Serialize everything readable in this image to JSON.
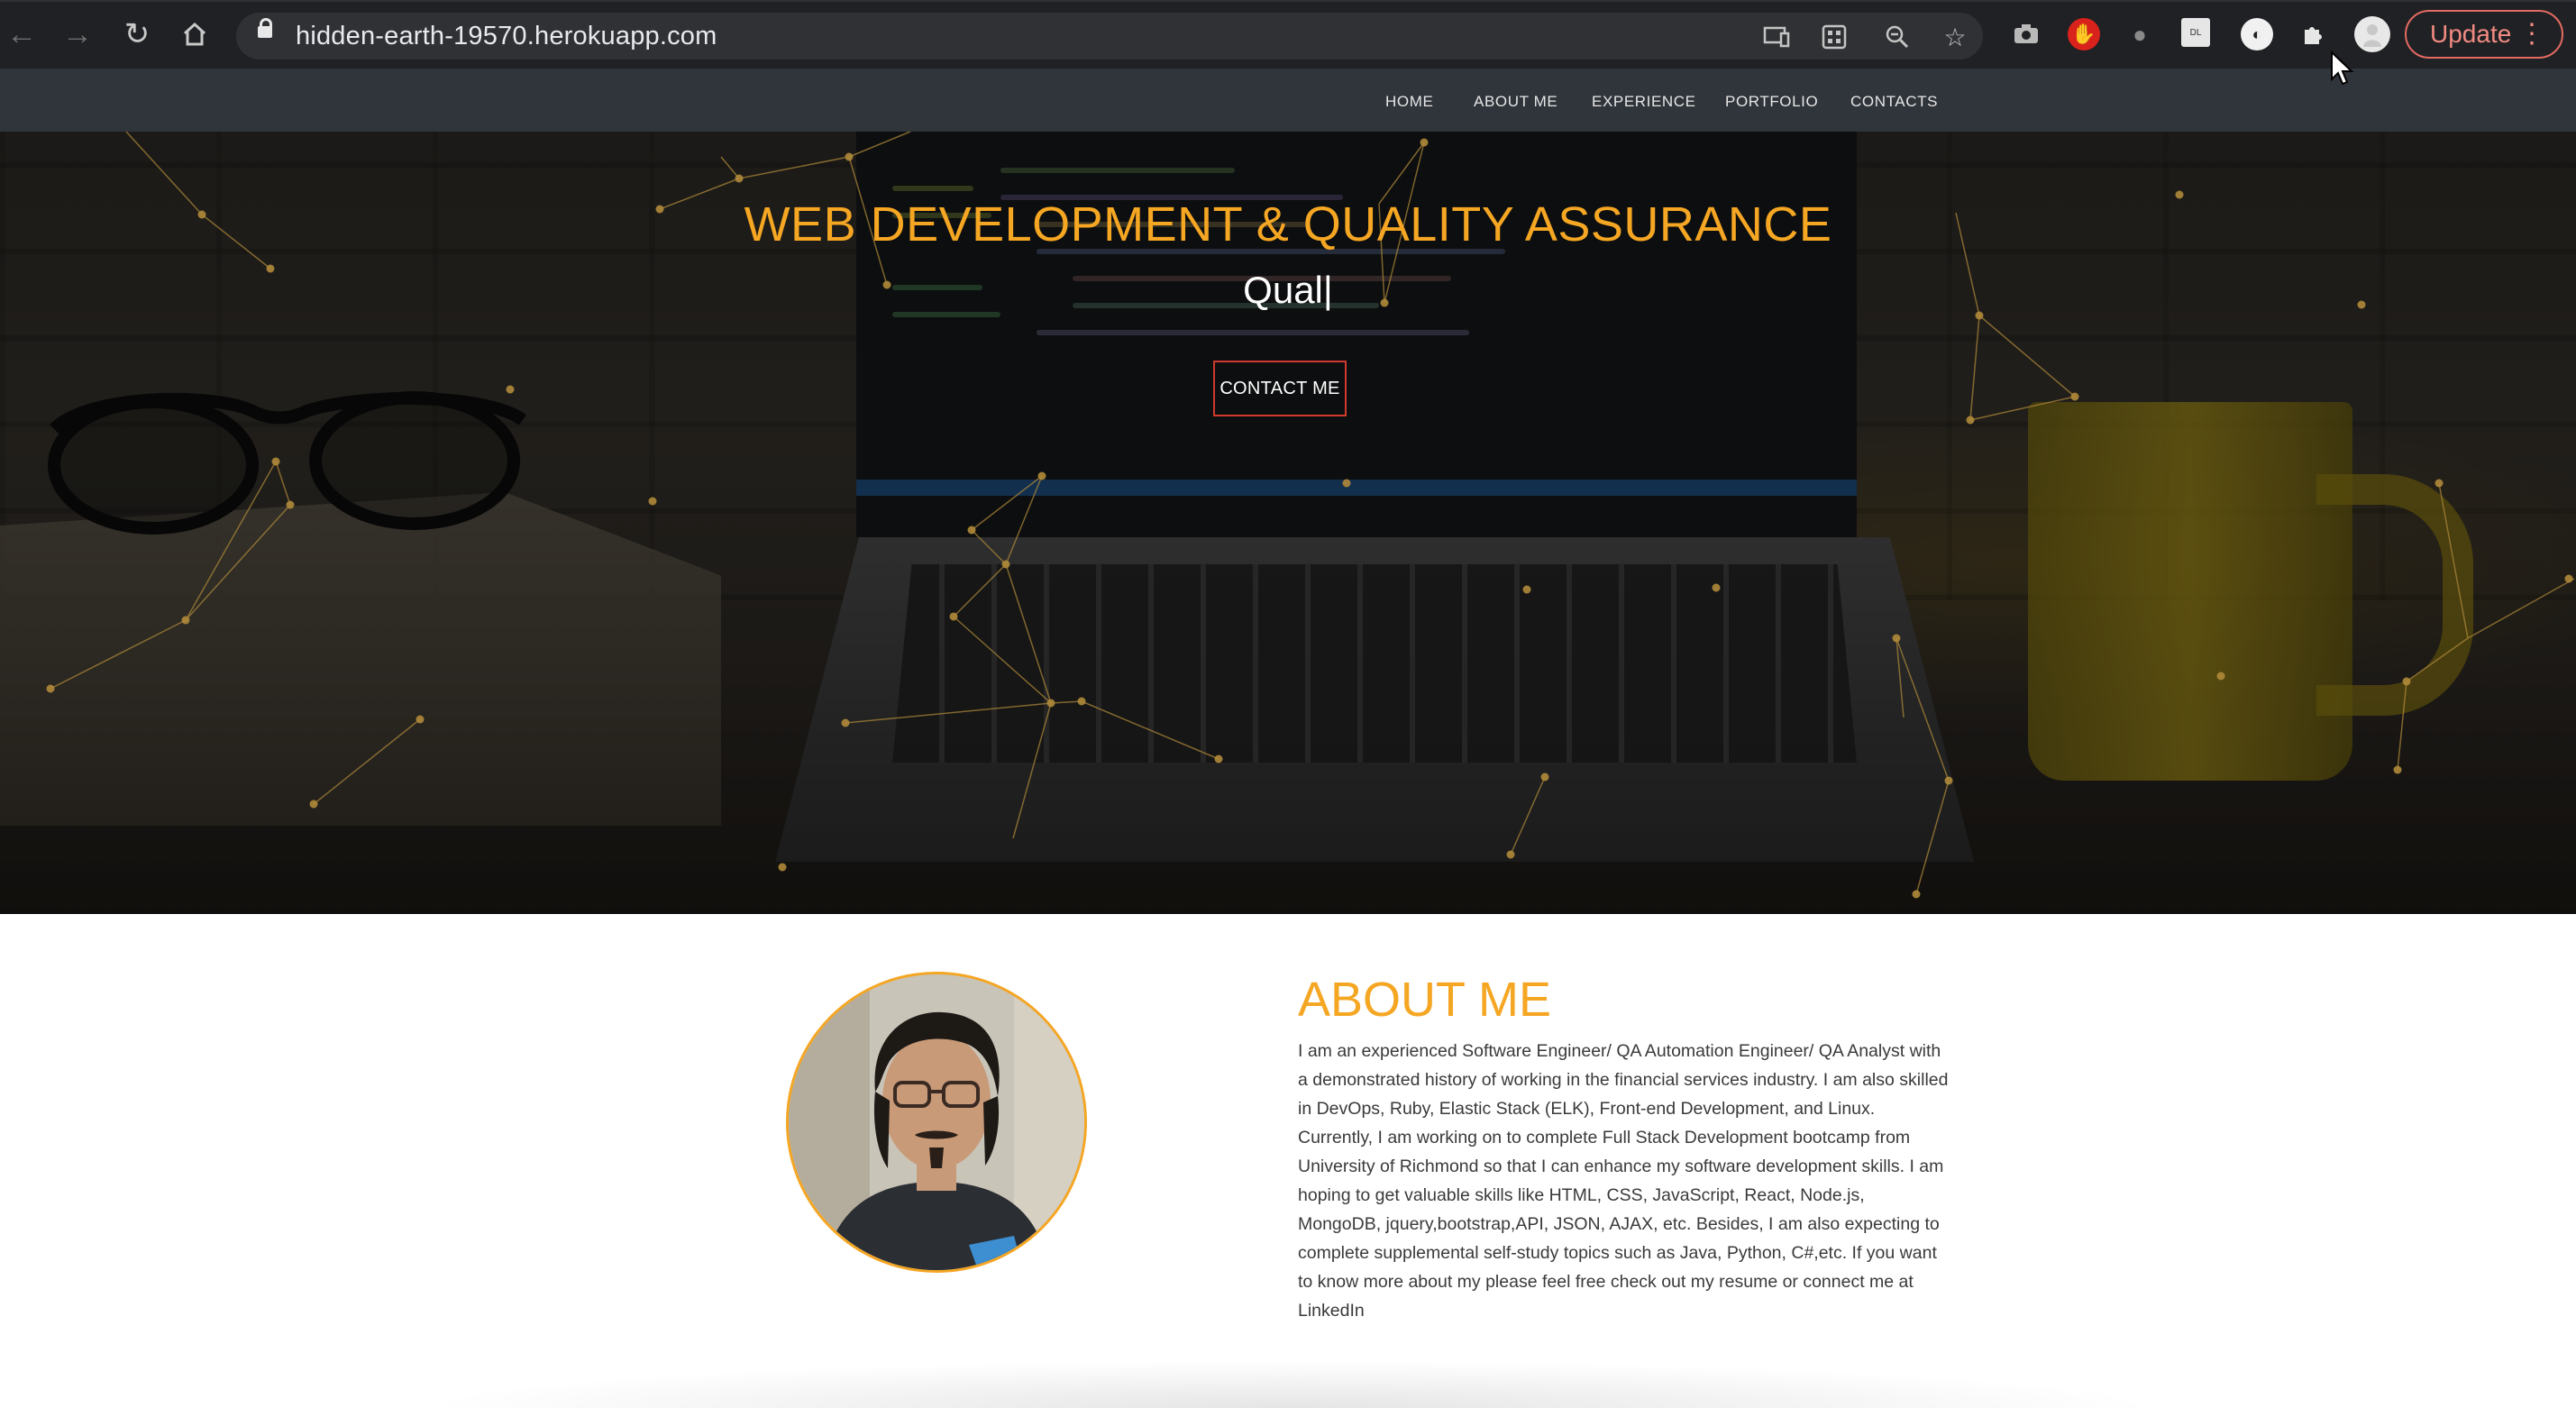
{
  "browser": {
    "url": "hidden-earth-19570.herokuapp.com",
    "update_label": "Update"
  },
  "nav": {
    "items": [
      "HOME",
      "ABOUT ME",
      "EXPERIENCE",
      "PORTFOLIO",
      "CONTACTS"
    ]
  },
  "hero": {
    "title": "WEB DEVELOPMENT & QUALITY ASSURANCE",
    "typed_text": "Qual|",
    "button_label": "CONTACT ME",
    "accent_color": "#f5a623",
    "button_border_color": "#d03a2f"
  },
  "about": {
    "title": "ABOUT ME",
    "body": "I am an experienced Software Engineer/ QA Automation Engineer/ QA Analyst with a demonstrated history of working in the financial services industry. I am also skilled in DevOps, Ruby, Elastic Stack (ELK), Front-end Development, and Linux. Currently, I am working on to complete Full Stack Development bootcamp from University of Richmond so that I can enhance my software development skills. I am hoping to get valuable skills like HTML, CSS, JavaScript, React, Node.js, MongoDB, jquery,bootstrap,API, JSON, AJAX, etc. Besides, I am also expecting to complete supplemental self-study topics such as Java, Python, C#,etc. If you want to know more about my please feel free check out my resume or connect me at LinkedIn"
  },
  "icons": {
    "back": "arrow-left-icon",
    "forward": "arrow-right-icon",
    "reload": "reload-icon",
    "home": "home-icon",
    "extensions": "puzzle-icon"
  }
}
